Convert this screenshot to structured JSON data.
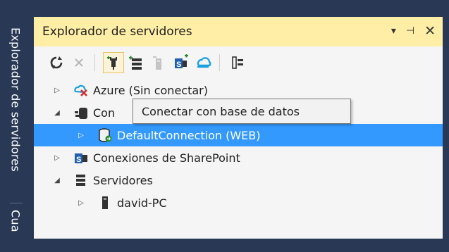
{
  "side_tabs": [
    "Explorador de servidores",
    "Cua"
  ],
  "panel": {
    "title": "Explorador de servidores",
    "controls": {
      "dropdown": "▾",
      "pin": "⊣",
      "close": "✕"
    }
  },
  "toolbar": {
    "icons": [
      "refresh-icon",
      "stop-icon",
      "connect-to-database-icon",
      "connect-to-server-icon",
      "disabled-server-icon",
      "sharepoint-connect-icon",
      "azure-connect-icon",
      "properties-icon"
    ]
  },
  "tree": {
    "items": [
      {
        "label": "Azure (Sin conectar)",
        "icon": "azure-disconnected-icon",
        "expander": "collapsed",
        "level": 0
      },
      {
        "label": "Con",
        "icon": "data-connections-icon",
        "expander": "expanded",
        "level": 0
      },
      {
        "label": "DefaultConnection (WEB)",
        "icon": "database-icon",
        "expander": "collapsed",
        "level": 1,
        "selected": true
      },
      {
        "label": "Conexiones de SharePoint",
        "icon": "sharepoint-icon",
        "expander": "collapsed",
        "level": 0
      },
      {
        "label": "Servidores",
        "icon": "servers-icon",
        "expander": "expanded",
        "level": 0
      },
      {
        "label": "david-PC",
        "icon": "computer-icon",
        "expander": "collapsed",
        "level": 1
      }
    ]
  },
  "tooltip": {
    "text": "Conectar con base de datos"
  },
  "colors": {
    "title_bg": "#ffefa6",
    "selection": "#3399ff",
    "frame": "#293955",
    "panel_bg": "#f5f5f5"
  }
}
